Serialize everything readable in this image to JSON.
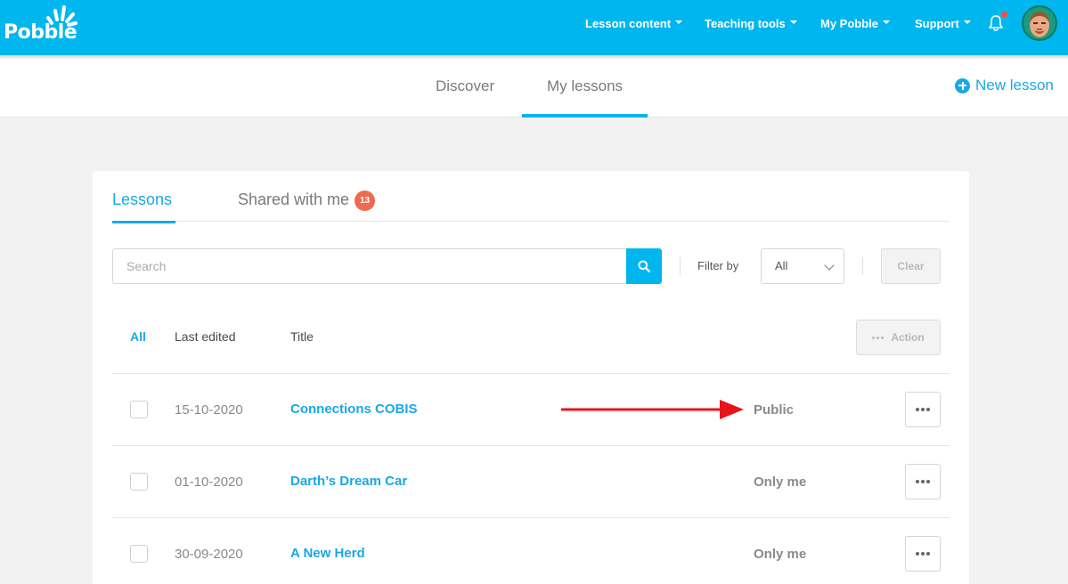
{
  "app": {
    "logo_text": "Pobble"
  },
  "topnav": {
    "items": [
      {
        "label": "Lesson content"
      },
      {
        "label": "Teaching tools"
      },
      {
        "label": "My Pobble"
      },
      {
        "label": "Support"
      }
    ]
  },
  "subnav": {
    "tabs": [
      {
        "label": "Discover",
        "active": false
      },
      {
        "label": "My lessons",
        "active": true
      }
    ],
    "new_lesson_label": "New lesson"
  },
  "card": {
    "tabs": [
      {
        "label": "Lessons",
        "active": true
      },
      {
        "label": "Shared with me",
        "badge": "13",
        "active": false
      }
    ],
    "search": {
      "placeholder": "Search",
      "value": ""
    },
    "filter": {
      "label": "Filter by",
      "selected": "All"
    },
    "clear_label": "Clear",
    "action_label": "Action",
    "columns": {
      "all": "All",
      "last_edited": "Last edited",
      "title": "Title"
    },
    "rows": [
      {
        "date": "15-10-2020",
        "title": "Connections COBIS",
        "visibility": "Public"
      },
      {
        "date": "01-10-2020",
        "title": "Darth’s Dream Car",
        "visibility": "Only me"
      },
      {
        "date": "30-09-2020",
        "title": "A New Herd",
        "visibility": "Only me"
      }
    ]
  },
  "colors": {
    "brand": "#00b6ef",
    "link": "#1aa8e4",
    "badge": "#f06a4f",
    "annotation_arrow": "#e8141b"
  },
  "icons": {
    "bell": "bell-icon",
    "search": "search-icon",
    "plus": "plus-circle-icon",
    "more": "ellipsis-icon",
    "chevron": "chevron-down-icon"
  }
}
